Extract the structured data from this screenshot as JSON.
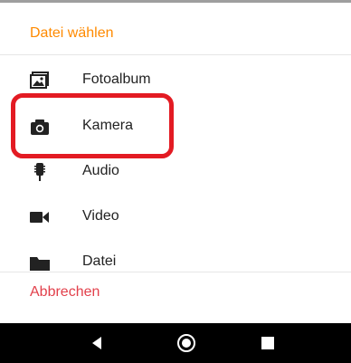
{
  "dialog": {
    "title": "Datei wählen",
    "items": [
      {
        "label": "Fotoalbum",
        "icon": "photo-album-icon"
      },
      {
        "label": "Kamera",
        "icon": "camera-icon"
      },
      {
        "label": "Audio",
        "icon": "microphone-icon"
      },
      {
        "label": "Video",
        "icon": "video-camera-icon"
      },
      {
        "label": "Datei",
        "icon": "folder-icon"
      }
    ],
    "cancel_label": "Abbrechen",
    "highlighted_item": "Kamera"
  },
  "colors": {
    "title": "#ff8a00",
    "cancel": "#e2404b",
    "highlight": "#e31b23",
    "nav_bar": "#000000"
  },
  "nav": {
    "buttons": [
      "back-icon",
      "home-icon",
      "recents-icon"
    ]
  }
}
